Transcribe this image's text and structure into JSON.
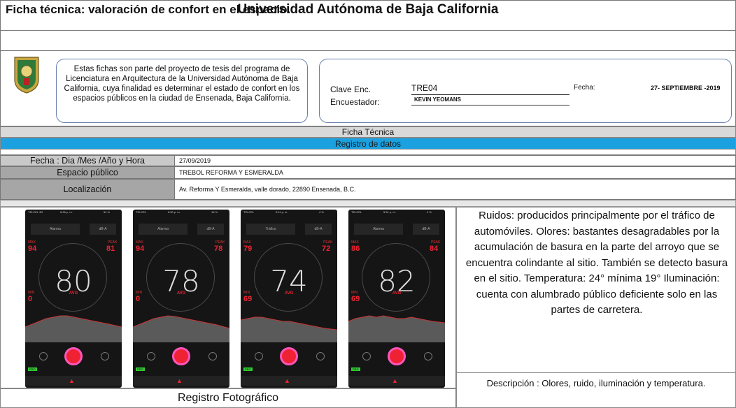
{
  "header": {
    "page_title": "Ficha técnica: valoración de confort en el espacio.",
    "university": "Universidad Autónoma de Baja California"
  },
  "intro": {
    "text": "Estas fichas son parte del proyecto de tesis del programa de Licenciatura en Arquitectura de la Universidad Autónoma de Baja California, cuya finalidad es determinar el estado de confort en los espacios públicos en la ciudad de Ensenada, Baja California."
  },
  "encuesta": {
    "clave_label": "Clave Enc.",
    "clave_value": "TRE04",
    "encuestador_label": "Encuestador:",
    "encuestador_value": "KEVIN YEOMANS",
    "fecha_label": "Fecha:",
    "fecha_value": "27- SEPTIEMBRE  -2019"
  },
  "sections": {
    "ficha": "Ficha Técnica",
    "registro": "Registro de datos"
  },
  "registro": [
    {
      "label": "Fecha : Dia /Mes /Año  y Hora",
      "value": "27/09/2019"
    },
    {
      "label": "Espacio público",
      "value": "TREBOL REFORMA Y ESMERALDA"
    },
    {
      "label": "Localización",
      "value": "Av. Reforma Y Esmeralda, valle dorado, 22890 Ensenada, B.C."
    }
  ],
  "phones": [
    {
      "mode": "Alarma",
      "unit": "dB-A",
      "min_label": "MAX",
      "max_label": "PEAK",
      "max": "94",
      "peak": "81",
      "avg": "80",
      "avg_label": "AVG",
      "min_title": "MIN",
      "min": "0",
      "time": "6:26 p. m.",
      "carrier": "TELCEL  3G",
      "battery": "54 %"
    },
    {
      "mode": "Alarma",
      "unit": "dB-A",
      "min_label": "MAX",
      "max_label": "PEAK",
      "max": "94",
      "peak": "78",
      "avg": "78",
      "avg_label": "AVG",
      "min_title": "MIN",
      "min": "0",
      "time": "6:50 p. m.",
      "carrier": "TELCEL",
      "battery": "16 %"
    },
    {
      "mode": "Tráfico",
      "unit": "dB-A",
      "min_label": "MAX",
      "max_label": "PEAK",
      "max": "79",
      "peak": "72",
      "avg": "74",
      "avg_label": "AVG",
      "min_title": "MIN",
      "min": "69",
      "time": "5:11 p. m.",
      "carrier": "TELCEL",
      "battery": "4 %"
    },
    {
      "mode": "Alarma",
      "unit": "dB-A",
      "min_label": "MAX",
      "max_label": "PEAK",
      "max": "86",
      "peak": "84",
      "avg": "82",
      "avg_label": "AVG",
      "min_title": "MIN",
      "min": "69",
      "time": "5:51 p. m.",
      "carrier": "TELCEL",
      "battery": "4 %"
    }
  ],
  "notes": {
    "text": "Ruidos: producidos principalmente por el tráfico de automóviles. Olores: bastantes desagradables por la acumulación de basura en la parte del arroyo que se encuentra colindante al sitio. También se detecto basura en el sitio. Temperatura: 24° mínima 19° Iluminación: cuenta con alumbrado público deficiente solo en las partes de carretera."
  },
  "descripcion": "Descripción : Olores, ruido, iluminación  y temperatura.",
  "foto_caption": "Registro Fotográfico",
  "colors": {
    "registro_bar": "#1ba0e0",
    "gray": "#a6a6a6",
    "app_red": "#e22233"
  }
}
